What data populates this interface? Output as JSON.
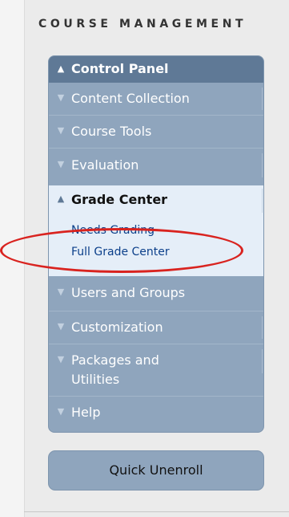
{
  "sidebar": {
    "section_title": "COURSE MANAGEMENT",
    "control_panel": {
      "title": "Control Panel",
      "items": [
        {
          "label": "Content Collection"
        },
        {
          "label": "Course Tools"
        },
        {
          "label": "Evaluation"
        },
        {
          "label": "Grade Center",
          "sub_items": [
            "Needs Grading",
            "Full Grade Center"
          ]
        },
        {
          "label": "Users and Groups"
        },
        {
          "label": "Customization"
        },
        {
          "label": "Packages and",
          "label_line2": "Utilities"
        },
        {
          "label": "Help"
        }
      ]
    },
    "quick_unenroll_label": "Quick Unenroll"
  },
  "icons": {
    "collapsed": "chevron-down-icon",
    "expanded": "chevron-up-icon",
    "submenu": "double-chevron-right-icon"
  },
  "colors": {
    "panel": "#8fa5bd",
    "panel_header": "#5f7996",
    "expanded_bg": "#e5eef8",
    "highlight": "#d9231f"
  }
}
